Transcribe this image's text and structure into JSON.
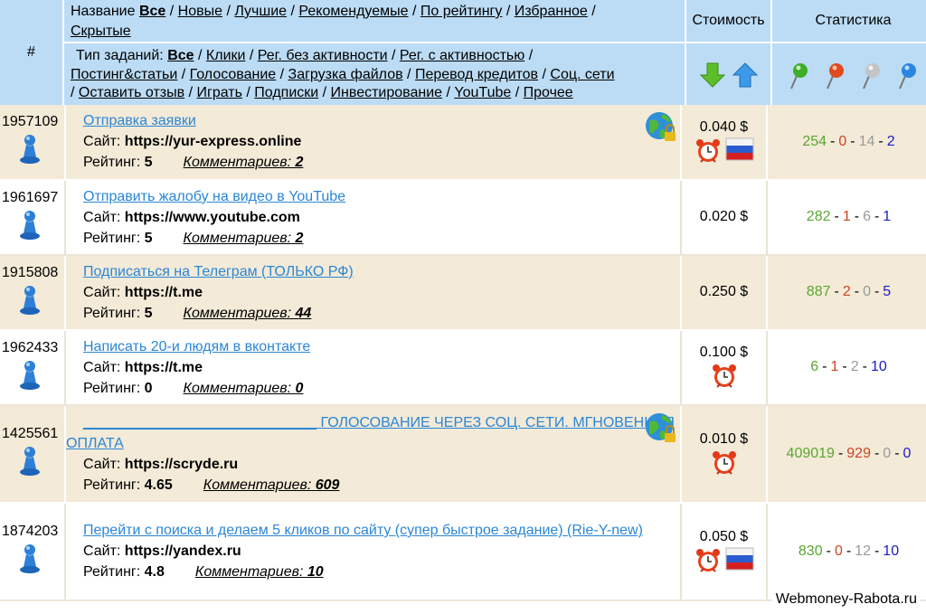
{
  "header": {
    "num_label": "#",
    "name_label": "Название",
    "sort_links": [
      "Все",
      "Новые",
      "Лучшие",
      "Рекомендуемые",
      "По рейтингу",
      "Избранное",
      "Скрытые"
    ],
    "type_label": "Тип заданий:",
    "type_links": [
      "Все",
      "Клики",
      "Рег. без активности",
      "Рег. с активностью",
      "Постинг&статьи",
      "Голосование",
      "Загрузка файлов",
      "Перевод кредитов",
      "Соц. сети",
      "Оставить отзыв",
      "Играть",
      "Подписки",
      "Инвестирование",
      "YouTube",
      "Прочее"
    ],
    "cost_label": "Стоимость",
    "stat_label": "Статистика"
  },
  "rows": [
    {
      "id": "1957109",
      "title": "Отправка заявки",
      "site_label": "Сайт:",
      "site": "https://yur-express.online",
      "rating_label": "Рейтинг:",
      "rating": "5",
      "comments_label": "Комментариев:",
      "comments": "2",
      "price": "0.040 $",
      "timer": true,
      "flag": true,
      "globe": true,
      "s1": "254",
      "s2": "0",
      "s3": "14",
      "s4": "2"
    },
    {
      "id": "1961697",
      "title": "Отправить жалобу на видео в YouTube",
      "site_label": "Сайт:",
      "site": "https://www.youtube.com",
      "rating_label": "Рейтинг:",
      "rating": "5",
      "comments_label": "Комментариев:",
      "comments": "2",
      "price": "0.020 $",
      "timer": false,
      "flag": false,
      "globe": false,
      "s1": "282",
      "s2": "1",
      "s3": "6",
      "s4": "1"
    },
    {
      "id": "1915808",
      "title": "Подписаться на Телеграм (ТОЛЬКО РФ)",
      "site_label": "Сайт:",
      "site": "https://t.me",
      "rating_label": "Рейтинг:",
      "rating": "5",
      "comments_label": "Комментариев:",
      "comments": "44",
      "price": "0.250 $",
      "timer": false,
      "flag": false,
      "globe": false,
      "s1": "887",
      "s2": "2",
      "s3": "0",
      "s4": "5"
    },
    {
      "id": "1962433",
      "title": "Написать 20-и людям в вконтакте",
      "site_label": "Сайт:",
      "site": "https://t.me",
      "rating_label": "Рейтинг:",
      "rating": "0",
      "comments_label": "Комментариев:",
      "comments": "0",
      "price": "0.100 $",
      "timer": true,
      "flag": false,
      "globe": false,
      "s1": "6",
      "s2": "1",
      "s3": "2",
      "s4": "10"
    },
    {
      "id": "1425561",
      "title": "_____________________________ ГОЛОСОВАНИЕ ЧЕРЕЗ СОЦ. СЕТИ. МГНОВЕННАЯ ОПЛАТА",
      "site_label": "Сайт:",
      "site": "https://scryde.ru",
      "rating_label": "Рейтинг:",
      "rating": "4.65",
      "comments_label": "Комментариев:",
      "comments": "609",
      "price": "0.010 $",
      "timer": true,
      "flag": false,
      "globe": true,
      "s1": "409019",
      "s2": "929",
      "s3": "0",
      "s4": "0"
    },
    {
      "id": "1874203",
      "title": "Перейти с поиска и делаем 5 кликов по сайту (супер быстрое задание) (Rie-Y-new)",
      "site_label": "Сайт:",
      "site": "https://yandex.ru",
      "rating_label": "Рейтинг:",
      "rating": "4.8",
      "comments_label": "Комментариев:",
      "comments": "10",
      "price": "0.050 $",
      "timer": true,
      "flag": true,
      "globe": false,
      "s1": "830",
      "s2": "0",
      "s3": "12",
      "s4": "10"
    }
  ],
  "watermark": "Webmoney-Rabota.ru",
  "colors": {
    "header_bg": "#bcdcf5",
    "row_odd_bg": "#f3ead7",
    "link": "#2b86d6",
    "stat_green": "#5aa632",
    "stat_red": "#cc4422",
    "stat_silver": "#9a9a9a",
    "stat_blue": "#1a1ac8"
  },
  "icons": {
    "sort_down": "green-down-arrow-icon",
    "sort_up": "blue-up-arrow-icon",
    "stat1": "green-pin-icon",
    "stat2": "red-pin-icon",
    "stat3": "silver-pin-icon",
    "stat4": "blue-pin-icon",
    "task": "pawn-icon",
    "lock": "globe-lock-icon",
    "timer": "alarm-clock-icon",
    "flag": "russia-flag-icon"
  }
}
